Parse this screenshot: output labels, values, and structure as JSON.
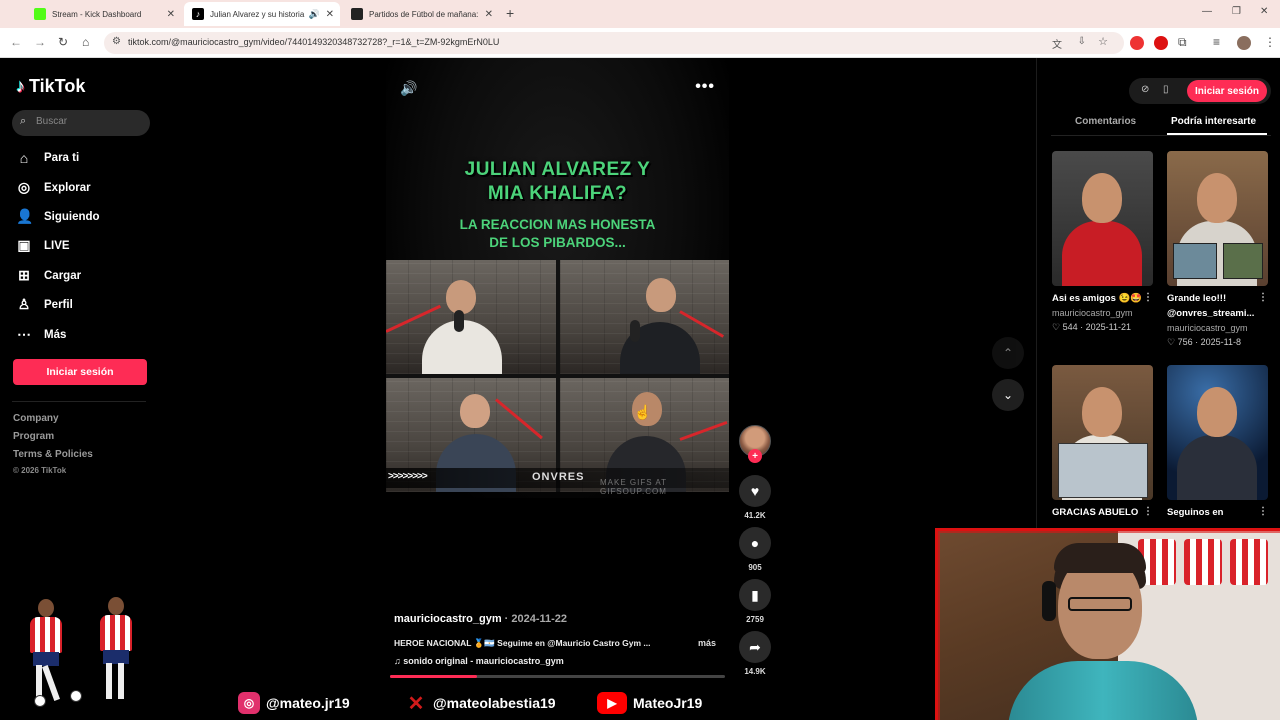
{
  "browser": {
    "tabs": [
      {
        "label": "Stream - Kick Dashboard",
        "fav_color": "#53fc18"
      },
      {
        "label": "Julian Alvarez y su historia c",
        "fav_color": "#000000"
      },
      {
        "label": "Partidos de Fútbol de mañana:",
        "fav_color": "#222222"
      }
    ],
    "url": "tiktok.com/@mauriciocastro_gym/video/7440149320348732728?_r=1&_t=ZM-92kgmErN0LU",
    "new_tab": "+"
  },
  "sidebar": {
    "brand": "TikTok",
    "search_placeholder": "Buscar",
    "nav": [
      {
        "label": "Para ti",
        "icon": "home-icon"
      },
      {
        "label": "Explorar",
        "icon": "compass-icon"
      },
      {
        "label": "Siguiendo",
        "icon": "following-icon"
      },
      {
        "label": "LIVE",
        "icon": "live-icon"
      },
      {
        "label": "Cargar",
        "icon": "upload-icon"
      },
      {
        "label": "Perfil",
        "icon": "profile-icon"
      },
      {
        "label": "Más",
        "icon": "more-icon"
      }
    ],
    "login_label": "Iniciar sesión",
    "footer": [
      "Company",
      "Program",
      "Terms & Policies"
    ],
    "copyright": "© 2026 TikTok"
  },
  "video": {
    "title_line1": "JULIAN ALVAREZ Y",
    "title_line2": "MIA KHALIFA?",
    "subtitle_line1": "LA REACCION MAS HONESTA",
    "subtitle_line2": "DE LOS PIBARDOS...",
    "arrows": ">>>>>>>>",
    "brand": "ONVRES",
    "watermark": "MAKE GIFS AT GIFSOUP.COM",
    "author": "mauriciocastro_gym",
    "date": " · 2024-11-22",
    "caption": "HEROE NACIONAL 🏅🇦🇷 Seguime en @Mauricio Castro Gym ...",
    "more": "más",
    "music": "♫  sonido original - mauriciocastro_gym",
    "progress": 0.26
  },
  "actions": {
    "likes": "41.2K",
    "comments": "905",
    "saves": "2759",
    "shares": "14.9K"
  },
  "right_panel": {
    "login_label": "Iniciar sesión",
    "tabs": [
      "Comentarios",
      "Podría interesarte"
    ],
    "cards": [
      {
        "title": "Asi es amigos 😉🤩",
        "user": "mauriciocastro_gym",
        "stats": "♡ 544 · 2025-11-21"
      },
      {
        "title": "Grande leo!!! @onvres_streami...",
        "user": "mauriciocastro_gym",
        "stats": "♡ 756 · 2025-11-8"
      },
      {
        "title": "GRACIAS ABUELO",
        "user": "",
        "stats": ""
      },
      {
        "title": "Seguinos en",
        "user": "",
        "stats": ""
      }
    ]
  },
  "overlay": {
    "socials": [
      {
        "handle": "@mateo.jr19",
        "icon": "instagram-icon",
        "color": "#e1306c"
      },
      {
        "handle": "@mateolabestia19",
        "icon": "x-icon",
        "color": "#d11a1a"
      },
      {
        "handle": "MateoJr19",
        "icon": "youtube-icon",
        "color": "#ff0000"
      }
    ]
  },
  "colors": {
    "accent": "#fe2c55",
    "title_green": "#4cd37a"
  }
}
